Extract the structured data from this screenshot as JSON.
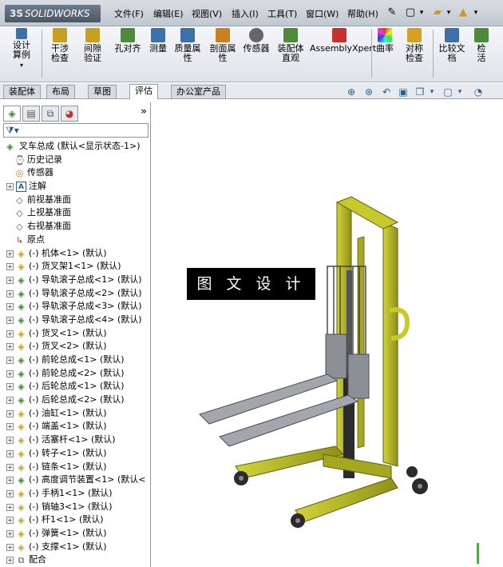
{
  "app": {
    "logo_text": "SOLIDWORKS",
    "logo_prefix": "3S"
  },
  "menu": [
    {
      "label": "文件(F)"
    },
    {
      "label": "编辑(E)"
    },
    {
      "label": "视图(V)"
    },
    {
      "label": "插入(I)"
    },
    {
      "label": "工具(T)"
    },
    {
      "label": "窗口(W)"
    },
    {
      "label": "帮助(H)"
    }
  ],
  "commands": [
    {
      "label": "设计算例",
      "icon": "study-icon",
      "color": "#3d6fa8"
    },
    {
      "label": "干涉检查",
      "icon": "interference-icon",
      "color": "#c8a020"
    },
    {
      "label": "间隙验证",
      "icon": "clearance-icon",
      "color": "#c8a020"
    },
    {
      "label": "孔对齐",
      "icon": "hole-align-icon",
      "color": "#4e8a3a"
    },
    {
      "label": "测量",
      "icon": "measure-icon",
      "color": "#3d6fa8"
    },
    {
      "label": "质量属性",
      "icon": "mass-properties-icon",
      "color": "#3d6fa8"
    },
    {
      "label": "剖面属性",
      "icon": "section-properties-icon",
      "color": "#c88020"
    },
    {
      "label": "传感器",
      "icon": "sensor-icon",
      "color": "#555555"
    },
    {
      "label": "装配体直观",
      "icon": "assembly-visualization-icon",
      "color": "#4e8a3a"
    },
    {
      "label": "AssemblyXpert",
      "icon": "assemblyxpert-icon",
      "color": "#c83030"
    },
    {
      "label": "曲率",
      "icon": "curvature-icon",
      "color": "#8a3ac8"
    },
    {
      "label": "对称检查",
      "icon": "symmetry-check-icon",
      "color": "#d8a020"
    },
    {
      "label": "比较文档",
      "icon": "compare-documents-icon",
      "color": "#3d6fa8"
    },
    {
      "label": "检活",
      "icon": "check-icon",
      "color": "#4e8a3a"
    }
  ],
  "tabs": [
    {
      "label": "装配体",
      "active": false
    },
    {
      "label": "布局",
      "active": false
    },
    {
      "label": "草图",
      "active": false
    },
    {
      "label": "评估",
      "active": true
    },
    {
      "label": "办公室产品",
      "active": false
    }
  ],
  "tree": {
    "root": "叉车总成 (默认<显示状态-1>)",
    "items": [
      {
        "label": "历史记录",
        "icon": "history-icon",
        "expandable": false
      },
      {
        "label": "传感器",
        "icon": "sensor-folder-icon",
        "expandable": false
      },
      {
        "label": "注解",
        "icon": "annotations-icon",
        "expandable": true
      },
      {
        "label": "前视基准面",
        "icon": "plane-icon",
        "expandable": false
      },
      {
        "label": "上视基准面",
        "icon": "plane-icon",
        "expandable": false
      },
      {
        "label": "右视基准面",
        "icon": "plane-icon",
        "expandable": false
      },
      {
        "label": "原点",
        "icon": "origin-icon",
        "expandable": false
      },
      {
        "label": "(-) 机体<1> (默认)",
        "icon": "part-icon",
        "expandable": true
      },
      {
        "label": "(-) 货叉架1<1> (默认)",
        "icon": "part-icon",
        "expandable": true
      },
      {
        "label": "(-) 导轨滚子总成<1> (默认)",
        "icon": "subassembly-icon",
        "expandable": true
      },
      {
        "label": "(-) 导轨滚子总成<2> (默认)",
        "icon": "subassembly-icon",
        "expandable": true
      },
      {
        "label": "(-) 导轨滚子总成<3> (默认)",
        "icon": "subassembly-icon",
        "expandable": true
      },
      {
        "label": "(-) 导轨滚子总成<4> (默认)",
        "icon": "subassembly-icon",
        "expandable": true
      },
      {
        "label": "(-) 货叉<1> (默认)",
        "icon": "part-icon",
        "expandable": true
      },
      {
        "label": "(-) 货叉<2> (默认)",
        "icon": "part-icon",
        "expandable": true
      },
      {
        "label": "(-) 前轮总成<1> (默认)",
        "icon": "subassembly-icon",
        "expandable": true
      },
      {
        "label": "(-) 前轮总成<2> (默认)",
        "icon": "subassembly-icon",
        "expandable": true
      },
      {
        "label": "(-) 后轮总成<1> (默认)",
        "icon": "subassembly-icon",
        "expandable": true
      },
      {
        "label": "(-) 后轮总成<2> (默认)",
        "icon": "subassembly-icon",
        "expandable": true
      },
      {
        "label": "(-) 油缸<1> (默认)",
        "icon": "part-icon",
        "expandable": true
      },
      {
        "label": "(-) 端盖<1> (默认)",
        "icon": "part-icon",
        "expandable": true
      },
      {
        "label": "(-) 活塞杆<1> (默认)",
        "icon": "part-icon",
        "expandable": true
      },
      {
        "label": "(-) 转子<1> (默认)",
        "icon": "part-icon",
        "expandable": true
      },
      {
        "label": "(-) 链条<1> (默认)",
        "icon": "part-icon",
        "expandable": true
      },
      {
        "label": "(-) 高度调节装置<1> (默认<",
        "icon": "subassembly-icon",
        "expandable": true
      },
      {
        "label": "(-) 手柄1<1> (默认)",
        "icon": "part-icon",
        "expandable": true
      },
      {
        "label": "(-) 销轴3<1> (默认)",
        "icon": "part-icon",
        "expandable": true
      },
      {
        "label": "(-) 杆1<1> (默认)",
        "icon": "part-icon",
        "expandable": true
      },
      {
        "label": "(-) 弹簧<1> (默认)",
        "icon": "part-icon",
        "expandable": true
      },
      {
        "label": "(-) 支撑<1> (默认)",
        "icon": "part-icon",
        "expandable": true
      },
      {
        "label": "配合",
        "icon": "mates-icon",
        "expandable": true
      }
    ]
  },
  "watermark": "图 文 设 计",
  "colors": {
    "frame": "#b7b91e",
    "frame_dark": "#7d7f12",
    "steel": "#8c9096",
    "wheel": "#2b2b2b"
  }
}
